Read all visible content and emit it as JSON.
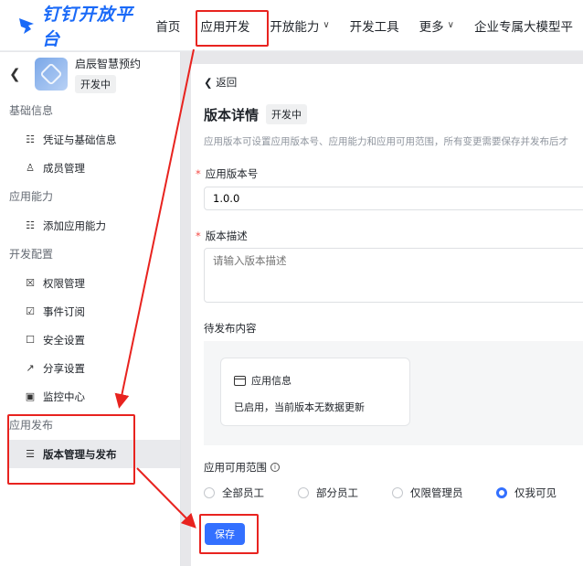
{
  "brand": {
    "name": "钉钉开放平台"
  },
  "nav": {
    "items": [
      {
        "label": "首页",
        "chevron": false
      },
      {
        "label": "应用开发",
        "chevron": false
      },
      {
        "label": "开放能力",
        "chevron": true
      },
      {
        "label": "开发工具",
        "chevron": false
      },
      {
        "label": "更多",
        "chevron": true
      },
      {
        "label": "企业专属大模型平",
        "chevron": false
      }
    ]
  },
  "sidebar": {
    "app_name": "启辰智慧预约",
    "app_status": "开发中",
    "groups": [
      {
        "title": "基础信息",
        "items": [
          {
            "label": "凭证与基础信息",
            "icon": "credential-icon"
          },
          {
            "label": "成员管理",
            "icon": "member-icon"
          }
        ]
      },
      {
        "title": "应用能力",
        "items": [
          {
            "label": "添加应用能力",
            "icon": "add-capability-icon"
          }
        ]
      },
      {
        "title": "开发配置",
        "items": [
          {
            "label": "权限管理",
            "icon": "lock-icon"
          },
          {
            "label": "事件订阅",
            "icon": "event-icon"
          },
          {
            "label": "安全设置",
            "icon": "shield-icon"
          },
          {
            "label": "分享设置",
            "icon": "share-icon"
          },
          {
            "label": "监控中心",
            "icon": "monitor-icon"
          }
        ]
      },
      {
        "title": "应用发布",
        "items": [
          {
            "label": "版本管理与发布",
            "icon": "layers-icon",
            "selected": true
          }
        ]
      }
    ]
  },
  "main": {
    "back_label": "返回",
    "title": "版本详情",
    "status_badge": "开发中",
    "description": "应用版本可设置应用版本号、应用能力和应用可用范围，所有变更需要保存并发布后才",
    "version_label": "应用版本号",
    "version_value": "1.0.0",
    "desc_label": "版本描述",
    "desc_placeholder": "请输入版本描述",
    "pending_label": "待发布内容",
    "card_title": "应用信息",
    "card_body": "已启用，当前版本无数据更新",
    "scope_label": "应用可用范围",
    "scope_options": [
      "全部员工",
      "部分员工",
      "仅限管理员",
      "仅我可见"
    ],
    "scope_selected": "仅我可见",
    "save_label": "保存"
  },
  "colors": {
    "brand": "#1a6af8",
    "primary": "#3370ff",
    "annotation": "#e8231f"
  }
}
